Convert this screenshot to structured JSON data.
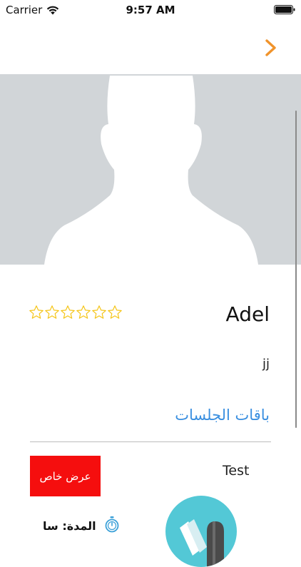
{
  "status_bar": {
    "carrier": "Carrier",
    "time": "9:57 AM"
  },
  "nav": {
    "forward_icon": "chevron-right-icon",
    "accent": "#f0932b"
  },
  "profile": {
    "name": "Adel",
    "rating": 0,
    "rating_max": 6,
    "bio": "jj",
    "avatar_icon": "person-silhouette-icon"
  },
  "sessions": {
    "title": "باقات الجلسات",
    "title_color": "#3a8fe0",
    "package": {
      "name": "Test",
      "offer_label": "عرض خاص",
      "offer_color": "#f50e0e",
      "duration_label": "المدة: سا",
      "timer_icon": "timer-icon",
      "icon": "package-icon"
    }
  }
}
